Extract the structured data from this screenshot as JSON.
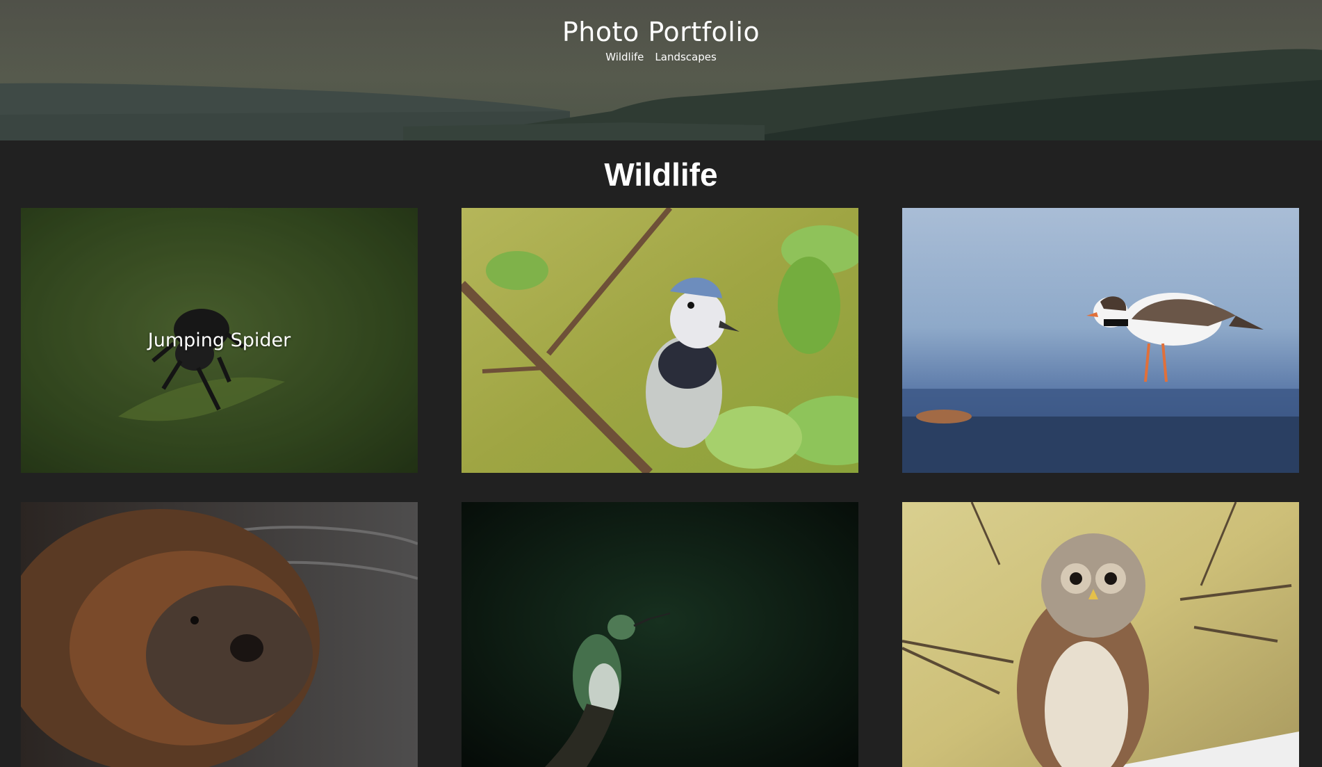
{
  "site": {
    "title": "Photo Portfolio",
    "nav": [
      {
        "label": "Wildlife"
      },
      {
        "label": "Landscapes"
      }
    ]
  },
  "section": {
    "title": "Wildlife"
  },
  "gallery": [
    {
      "caption": "Jumping Spider",
      "hovered": true,
      "icon": "jumping-spider-photo"
    },
    {
      "caption": "",
      "hovered": false,
      "icon": "blue-jay-photo"
    },
    {
      "caption": "",
      "hovered": false,
      "icon": "plover-photo"
    },
    {
      "caption": "",
      "hovered": false,
      "icon": "beaver-photo"
    },
    {
      "caption": "",
      "hovered": false,
      "icon": "hummingbird-photo"
    },
    {
      "caption": "",
      "hovered": false,
      "icon": "barred-owl-photo"
    }
  ],
  "colors": {
    "background": "#212121",
    "header_overlay": "#555849",
    "text": "#ffffff"
  }
}
